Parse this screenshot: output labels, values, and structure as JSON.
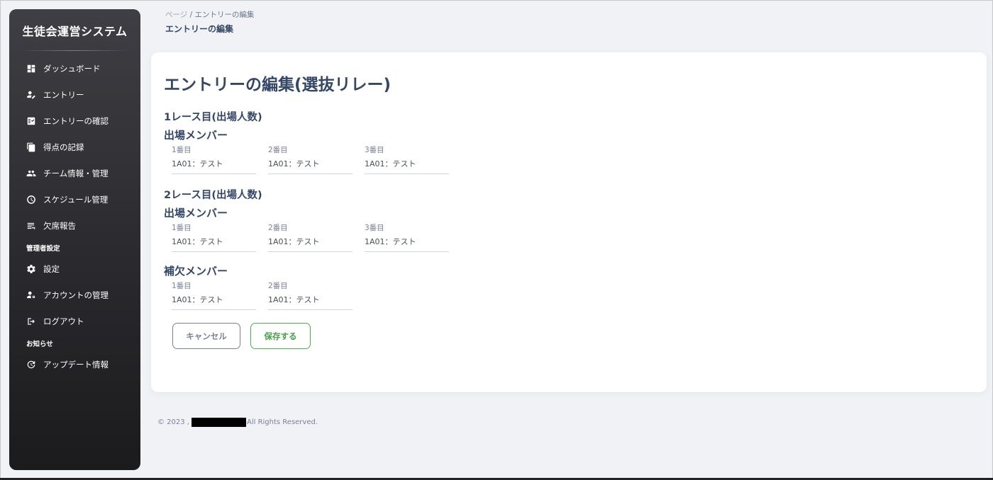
{
  "brand": {
    "title": "生徒会運営システム"
  },
  "sidebar": {
    "items": [
      {
        "label": "ダッシュボード",
        "icon": "dashboard-icon"
      },
      {
        "label": "エントリー",
        "icon": "person-edit-icon"
      },
      {
        "label": "エントリーの確認",
        "icon": "checklist-icon"
      },
      {
        "label": "得点の記録",
        "icon": "copy-icon"
      },
      {
        "label": "チーム情報・管理",
        "icon": "group-icon"
      },
      {
        "label": "スケジュール管理",
        "icon": "clock-icon"
      },
      {
        "label": "欠席報告",
        "icon": "list-icon"
      }
    ],
    "admin_section": "管理者設定",
    "admin_items": [
      {
        "label": "設定",
        "icon": "gear-icon"
      },
      {
        "label": "アカウントの管理",
        "icon": "manage-accounts-icon"
      },
      {
        "label": "ログアウト",
        "icon": "logout-icon"
      }
    ],
    "news_section": "お知らせ",
    "news_items": [
      {
        "label": "アップデート情報",
        "icon": "update-icon"
      }
    ]
  },
  "breadcrumb": {
    "root": "ページ",
    "separator": "/",
    "page": "エントリーの編集",
    "current": "エントリーの編集"
  },
  "main": {
    "title": "エントリーの編集(選抜リレー)",
    "races": [
      {
        "title": "1レース目(出場人数)",
        "members_title": "出場メンバー",
        "fields": [
          {
            "label": "1番目",
            "value": "1A01：テスト"
          },
          {
            "label": "2番目",
            "value": "1A01：テスト"
          },
          {
            "label": "3番目",
            "value": "1A01：テスト"
          }
        ]
      },
      {
        "title": "2レース目(出場人数)",
        "members_title": "出場メンバー",
        "fields": [
          {
            "label": "1番目",
            "value": "1A01：テスト"
          },
          {
            "label": "2番目",
            "value": "1A01：テスト"
          },
          {
            "label": "3番目",
            "value": "1A01：テスト"
          }
        ]
      }
    ],
    "substitutes": {
      "title": "補欠メンバー",
      "fields": [
        {
          "label": "1番目",
          "value": "1A01：テスト"
        },
        {
          "label": "2番目",
          "value": "1A01：テスト"
        }
      ]
    },
    "cancel_label": "キャンセル",
    "save_label": "保存する"
  },
  "footer": {
    "prefix": "© 2023 ,",
    "suffix": "All Rights Reserved."
  },
  "colors": {
    "save_accent": "#4caf50",
    "text_primary": "#344767",
    "background": "#f0f2f5"
  }
}
